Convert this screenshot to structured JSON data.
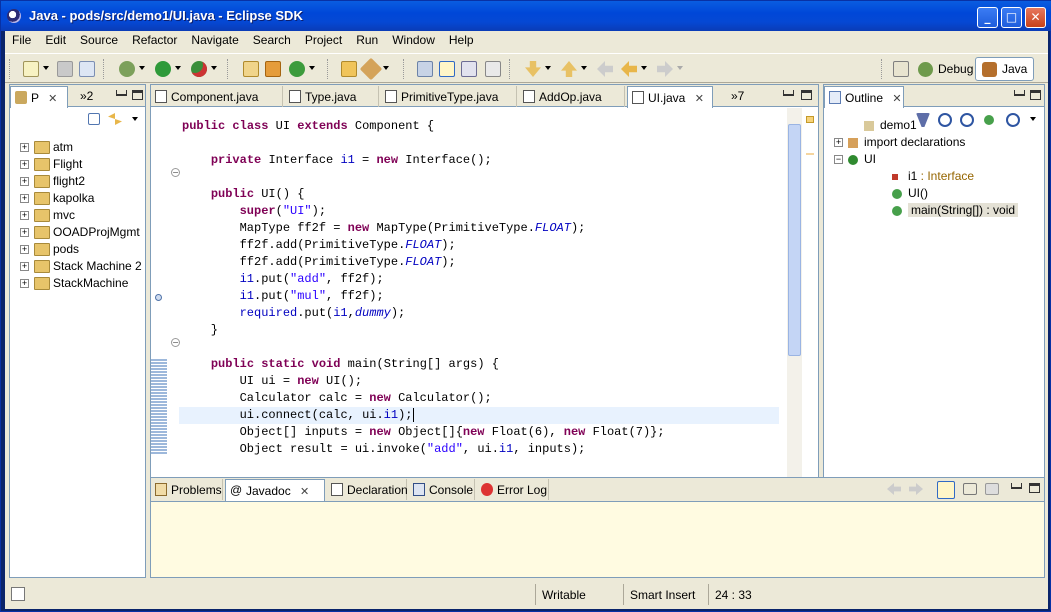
{
  "window": {
    "title": "Java - pods/src/demo1/UI.java - Eclipse SDK"
  },
  "menu": [
    "File",
    "Edit",
    "Source",
    "Refactor",
    "Navigate",
    "Search",
    "Project",
    "Run",
    "Window",
    "Help"
  ],
  "perspectives": {
    "debug": "Debug",
    "java": "Java"
  },
  "package_explorer": {
    "tab_label": "P",
    "overflow": "»2",
    "projects": [
      "atm",
      "Flight",
      "flight2",
      "kapolka",
      "mvc",
      "OOADProjMgmt",
      "pods",
      "Stack Machine 2",
      "StackMachine"
    ]
  },
  "editor": {
    "tabs": [
      "Component.java",
      "Type.java",
      "PrimitiveType.java",
      "AddOp.java",
      "UI.java"
    ],
    "active_tab": "UI.java",
    "overflow": "»7",
    "lines": [
      "public class UI extends Component {",
      "",
      "    private Interface i1 = new Interface();",
      "",
      "    public UI() {",
      "        super(\"UI\");",
      "        MapType ff2f = new MapType(PrimitiveType.FLOAT);",
      "        ff2f.add(PrimitiveType.FLOAT);",
      "        ff2f.add(PrimitiveType.FLOAT);",
      "        i1.put(\"add\", ff2f);",
      "        i1.put(\"mul\", ff2f);",
      "        required.put(i1,dummy);",
      "    }",
      "",
      "    public static void main(String[] args) {",
      "        UI ui = new UI();",
      "        Calculator calc = new Calculator();",
      "        ui.connect(calc, ui.i1);",
      "        Object[] inputs = new Object[]{new Float(6), new Float(7)};",
      "        Object result = ui.invoke(\"add\", ui.i1, inputs);"
    ]
  },
  "outline": {
    "tab_label": "Outline",
    "items": [
      {
        "label": "demo1"
      },
      {
        "label": "import declarations"
      },
      {
        "label": "UI"
      },
      {
        "label": "i1",
        "type": " : Interface"
      },
      {
        "label": "UI()"
      },
      {
        "label": "main(String[]) : void"
      }
    ]
  },
  "bottom_panel": {
    "tabs": [
      "Problems",
      "Javadoc",
      "Declaration",
      "Console",
      "Error Log"
    ],
    "active_tab": "Javadoc"
  },
  "status": {
    "writable": "Writable",
    "insert_mode": "Smart Insert",
    "position": "24 : 33"
  },
  "colors": {
    "keyword": "#7f0055",
    "field": "#0000c0",
    "string": "#2a00ff",
    "title_bar": "#0054e3",
    "panel_bg": "#ece9d8",
    "javadoc_bg": "#fffbe1"
  }
}
